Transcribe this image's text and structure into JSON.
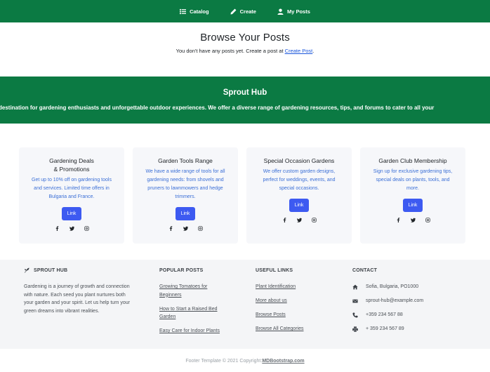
{
  "nav": {
    "catalog": "Catalog",
    "create": "Create",
    "my_posts": "My Posts"
  },
  "browse": {
    "title": "Browse Your Posts",
    "text": "You don't have any posts yet. Create a post at ",
    "link": "Create Post",
    "period": "."
  },
  "hero": {
    "title": "Sprout Hub",
    "text": "destination for gardening enthusiasts and unforgettable outdoor experiences. We offer a diverse range of gardening resources, tips, and forums to cater to all your"
  },
  "cards": [
    {
      "title_line1": "Gardening Deals",
      "title_line2": "& Promotions",
      "desc": "Get up to 10% off on gardening tools and services. Limited time offers in Bulgaria and France.",
      "button": "Link"
    },
    {
      "title_line1": "Garden Tools Range",
      "title_line2": "",
      "desc": "We have a wide range of tools for all gardening needs: from shovels and pruners to lawnmowers and hedge trimmers.",
      "button": "Link"
    },
    {
      "title_line1": "Special Occasion Gardens",
      "title_line2": "",
      "desc": "We offer custom garden designs, perfect for weddings, events, and special occasions.",
      "button": "Link"
    },
    {
      "title_line1": "Garden Club Membership",
      "title_line2": "",
      "desc": "Sign up for exclusive gardening tips, special deals on plants, tools, and more.",
      "button": "Link"
    }
  ],
  "footer": {
    "brand": "SPROUT HUB",
    "about": "Gardening is a journey of growth and connection with nature. Each seed you plant nurtures both your garden and your spirit. Let us help turn your green dreams into vibrant realities.",
    "popular_title": "POPULAR POSTS",
    "popular": [
      "Growing Tomatoes for Beginners",
      "How to Start a Raised Bed Garden",
      "Easy Care for Indoor Plants"
    ],
    "useful_title": "USEFUL LINKS",
    "useful": [
      "Plant Identification",
      "More about us",
      "Browse Posts",
      "Browse All Categories"
    ],
    "contact_title": "CONTACT",
    "address": "Sofia, Bulgaria, PO1000",
    "email": "sprout-hub@example.com",
    "phone": "+359 234 567 88",
    "fax": "+ 359 234 567 89"
  },
  "copyright": {
    "text": "Footer Template © 2021 Copyright:",
    "link": "MDBootstrap.com"
  },
  "colors": {
    "brand_green": "#0b7a43",
    "button_blue": "#3d5af1",
    "card_text_blue": "#3b6fd6"
  }
}
